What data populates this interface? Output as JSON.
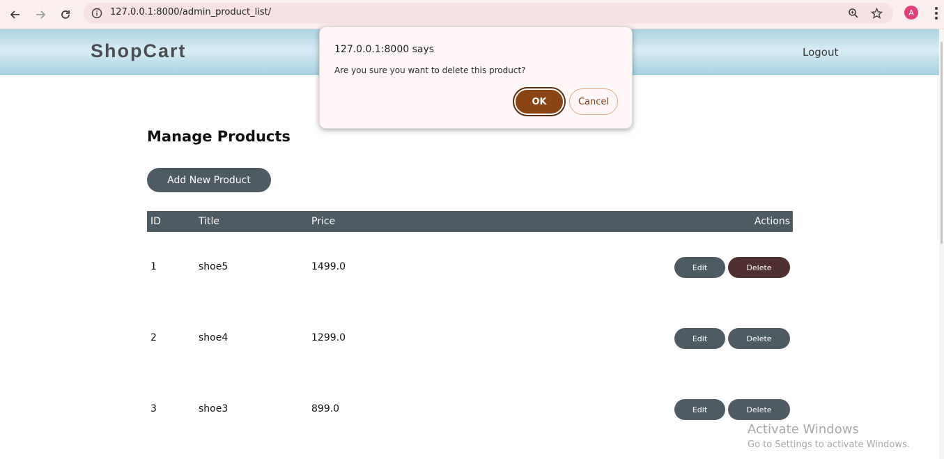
{
  "browser": {
    "url": "127.0.0.1:8000/admin_product_list/",
    "avatar_letter": "A",
    "icons": [
      "back-arrow-icon",
      "forward-arrow-icon",
      "reload-icon",
      "site-info-icon",
      "zoom-icon",
      "star-icon",
      "menu-icon"
    ]
  },
  "header": {
    "brand": "ShopCart",
    "logout": "Logout"
  },
  "main": {
    "title": "Manage Products",
    "add_button": "Add New Product",
    "table": {
      "columns": [
        "ID",
        "Title",
        "Price",
        "Actions"
      ],
      "rows": [
        {
          "id": "1",
          "title": "shoe5",
          "price": "1499.0",
          "edit": "Edit",
          "delete": "Delete"
        },
        {
          "id": "2",
          "title": "shoe4",
          "price": "1299.0",
          "edit": "Edit",
          "delete": "Delete"
        },
        {
          "id": "3",
          "title": "shoe3",
          "price": "899.0",
          "edit": "Edit",
          "delete": "Delete"
        }
      ]
    }
  },
  "dialog": {
    "title": "127.0.0.1:8000 says",
    "message": "Are you sure you want to delete this product?",
    "ok": "OK",
    "cancel": "Cancel"
  },
  "watermark": {
    "title": "Activate Windows",
    "subtitle": "Go to Settings to activate Windows."
  },
  "colors": {
    "primary_button": "#4d5b63",
    "active_delete": "#4f2f2f",
    "dialog_ok": "#8b4514"
  }
}
